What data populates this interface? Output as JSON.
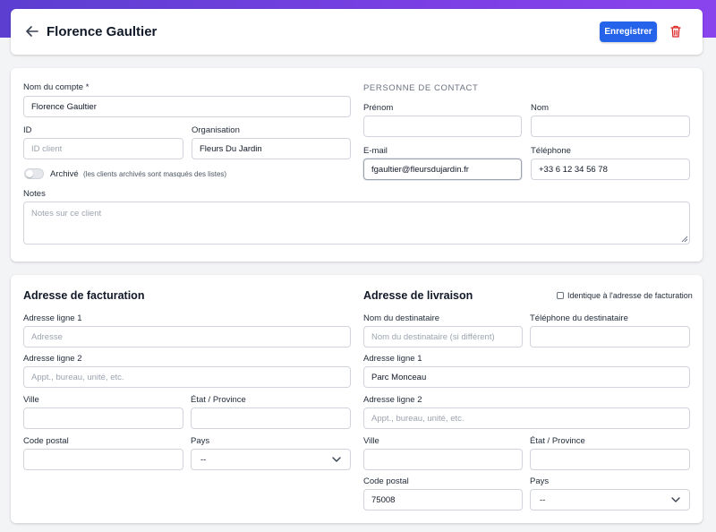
{
  "header": {
    "title": "Florence Gaultier",
    "save_label": "Enregistrer",
    "back_icon": "arrow-left-icon",
    "delete_icon": "trash-icon",
    "colors": {
      "primary": "#2563eb",
      "danger": "#dc2626",
      "banner": "#6d40e0"
    }
  },
  "account": {
    "name_label": "Nom du compte *",
    "name_value": "Florence Gaultier",
    "id_label": "ID",
    "id_placeholder": "ID client",
    "org_label": "Organisation",
    "org_value": "Fleurs Du Jardin",
    "archived_label": "Archivé",
    "archived_hint": "(les clients archivés sont masqués des listes)",
    "notes_label": "Notes",
    "notes_placeholder": "Notes sur ce client"
  },
  "contact": {
    "section_label": "Personne de contact",
    "firstname_label": "Prénom",
    "firstname_value": "",
    "lastname_label": "Nom",
    "lastname_value": "",
    "email_label": "E-mail",
    "email_value": "fgaultier@fleursdujardin.fr",
    "phone_label": "Téléphone",
    "phone_value": "+33 6 12 34 56 78"
  },
  "billing": {
    "title": "Adresse de facturation",
    "line1_label": "Adresse ligne 1",
    "line1_placeholder": "Adresse",
    "line2_label": "Adresse ligne 2",
    "line2_placeholder": "Appt., bureau, unité, etc.",
    "city_label": "Ville",
    "state_label": "État / Province",
    "postal_label": "Code postal",
    "country_label": "Pays",
    "country_value": "--"
  },
  "shipping": {
    "title": "Adresse de livraison",
    "same_as_billing_label": "Identique à l'adresse de facturation",
    "recipient_label": "Nom du destinataire",
    "recipient_placeholder": "Nom du destinataire (si différent)",
    "recipient_phone_label": "Téléphone du destinataire",
    "line1_label": "Adresse ligne 1",
    "line1_value": "Parc Monceau",
    "line2_label": "Adresse ligne 2",
    "line2_placeholder": "Appt., bureau, unité, etc.",
    "city_label": "Ville",
    "state_label": "État / Province",
    "postal_label": "Code postal",
    "postal_value": "75008",
    "country_label": "Pays",
    "country_value": "--"
  }
}
